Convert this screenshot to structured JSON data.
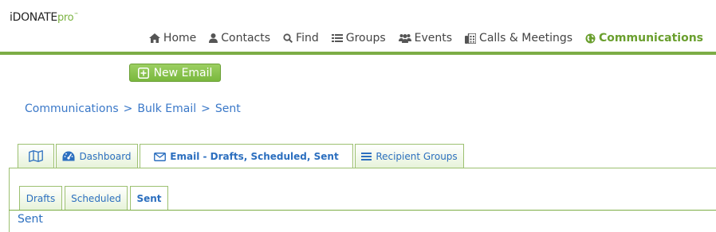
{
  "brand": {
    "main": "iDONATE",
    "suffix": "pro",
    "tm": "™"
  },
  "nav": {
    "items": [
      {
        "label": "Home",
        "icon": "home-icon"
      },
      {
        "label": "Contacts",
        "icon": "user-icon"
      },
      {
        "label": "Find",
        "icon": "search-icon"
      },
      {
        "label": "Groups",
        "icon": "list-icon"
      },
      {
        "label": "Events",
        "icon": "users-icon"
      },
      {
        "label": "Calls & Meetings",
        "icon": "address-book-icon"
      },
      {
        "label": "Communications",
        "icon": "globe-icon",
        "active": true
      }
    ]
  },
  "actions": {
    "new_email_label": "New Email",
    "new_email_icon": "plus-square-icon"
  },
  "breadcrumb": {
    "items": [
      "Communications",
      "Bulk Email",
      "Sent"
    ],
    "separator": ">"
  },
  "tabs": [
    {
      "label": "",
      "icon": "map-icon"
    },
    {
      "label": "Dashboard",
      "icon": "dashboard-icon"
    },
    {
      "label": "Email - Drafts, Scheduled, Sent",
      "icon": "envelope-icon",
      "active": true
    },
    {
      "label": "Recipient Groups",
      "icon": "bars-icon"
    }
  ],
  "subtabs": [
    {
      "label": "Drafts"
    },
    {
      "label": "Scheduled"
    },
    {
      "label": "Sent",
      "active": true
    }
  ],
  "section": {
    "title": "Sent"
  },
  "colors": {
    "accent_green": "#7cad45",
    "link_blue": "#2c6fbf",
    "nav_text": "#444444"
  }
}
